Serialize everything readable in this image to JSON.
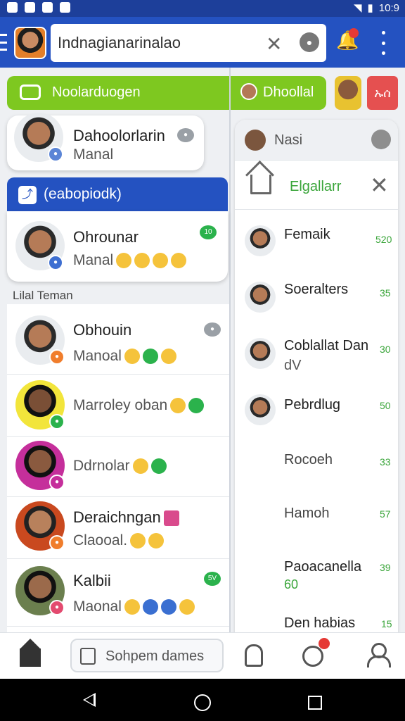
{
  "status": {
    "time": "10:9"
  },
  "header": {
    "search_value": "Indnagianarinalao"
  },
  "banner": {
    "title": "Noolarduogen",
    "contact": "Dhoollal",
    "right_label": "ኡሰ"
  },
  "pinned": {
    "name": "Dahoolorlarin",
    "sub": "Manal"
  },
  "group": {
    "title": "(eabopiodk)",
    "name": "Ohrounar",
    "sub": "Manal",
    "count": "10"
  },
  "section_label": "Lilal Teman",
  "chats": [
    {
      "name": "Obhouin",
      "sub": "Manoal"
    },
    {
      "name": "Marroley oban",
      "sub": ""
    },
    {
      "name": "Ddrnolar",
      "sub": ""
    },
    {
      "name": "Deraichngan",
      "sub": "Claooal."
    },
    {
      "name": "Kalbii",
      "sub": "Maonal",
      "count": "5V"
    }
  ],
  "right_panel": {
    "header": "Nasi",
    "tab": "Elgallarr",
    "items": [
      {
        "name": "Femaik",
        "count": "520"
      },
      {
        "name": "Soeralters",
        "count": "35"
      },
      {
        "name": "Coblallat Dan",
        "sub": "dV",
        "count": "30"
      },
      {
        "name": "Pebrdlug",
        "count": "50"
      },
      {
        "name": "Rocoeh",
        "count": "33"
      },
      {
        "name": "Hamoh",
        "count": "57"
      },
      {
        "name": "Paoacanella",
        "sub": "60",
        "count": "39"
      },
      {
        "name": "Den habias",
        "count": "15"
      }
    ]
  },
  "bottom_bar": {
    "search_placeholder": "Sohpem dames"
  }
}
